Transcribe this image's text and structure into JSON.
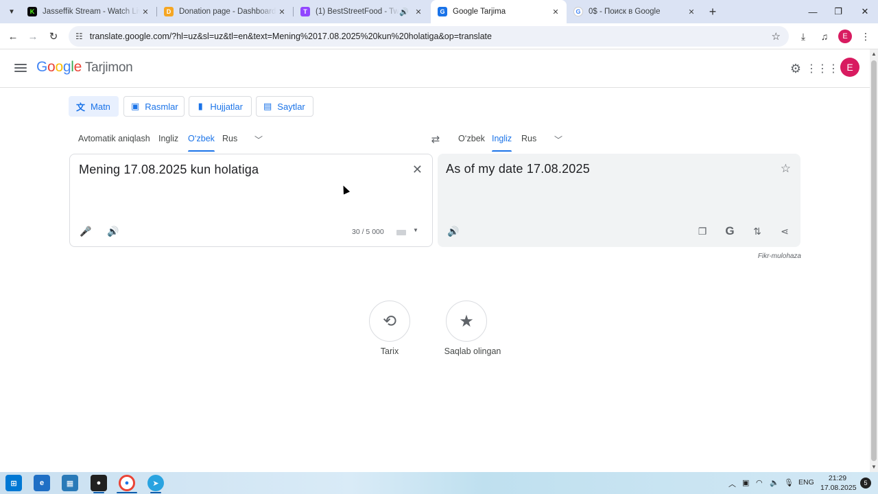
{
  "browser": {
    "tabs": [
      {
        "title": "Jasseffik Stream - Watch Live on",
        "favicon_color": "#0a0a0a",
        "favicon_glyph": "K"
      },
      {
        "title": "Donation page - Dashboard - D",
        "favicon_color": "#f5a623",
        "favicon_glyph": "D"
      },
      {
        "title": "(1) BestStreetFood - Twitch",
        "favicon_color": "#9146ff",
        "favicon_glyph": "T"
      },
      {
        "title": "Google Tarjima",
        "favicon_color": "#1a73e8",
        "favicon_glyph": "G"
      },
      {
        "title": "0$ - Поиск в Google",
        "favicon_color": "#ffffff",
        "favicon_glyph": "G"
      }
    ],
    "active_tab_index": 3,
    "url": "translate.google.com/?hl=uz&sl=uz&tl=en&text=Mening%2017.08.2025%20kun%20holatiga&op=translate",
    "profile_initial": "E"
  },
  "app": {
    "logo_word": [
      "G",
      "o",
      "o",
      "g",
      "l",
      "e"
    ],
    "product_name": "Tarjimon",
    "avatar_initial": "E",
    "modes": [
      {
        "label": "Matn",
        "icon": "translate-icon"
      },
      {
        "label": "Rasmlar",
        "icon": "image-icon"
      },
      {
        "label": "Hujjatlar",
        "icon": "document-icon"
      },
      {
        "label": "Saytlar",
        "icon": "website-icon"
      }
    ],
    "source_languages": [
      "Avtomatik aniqlash",
      "Ingliz",
      "O‘zbek",
      "Rus"
    ],
    "source_selected": "O‘zbek",
    "target_languages": [
      "O‘zbek",
      "Ingliz",
      "Rus"
    ],
    "target_selected": "Ingliz",
    "source_text": "Mening 17.08.2025 kun holatiga",
    "char_counter": "30 / 5 000",
    "translated_text": "As of my date 17.08.2025",
    "feedback_label": "Fikr-mulohaza",
    "history_label": "Tarix",
    "saved_label": "Saqlab olingan"
  },
  "taskbar": {
    "language": "ENG",
    "time": "21:29",
    "date": "17.08.2025",
    "notifications": "5"
  },
  "colors": {
    "accent": "#1a73e8",
    "tabstrip": "#dbe3f4",
    "avatar": "#d81b60"
  }
}
